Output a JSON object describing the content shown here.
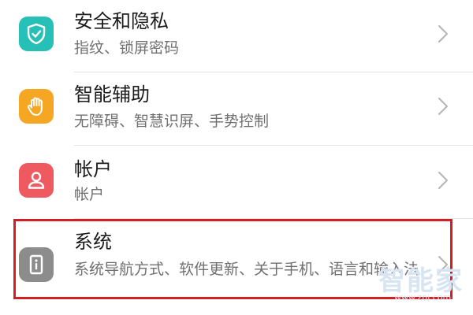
{
  "settings": {
    "items": [
      {
        "title": "安全和隐私",
        "subtitle": "指纹、锁屏密码",
        "icon": "shield-check-icon",
        "color": "#27c0b6"
      },
      {
        "title": "智能辅助",
        "subtitle": "无障碍、智慧识屏、手势控制",
        "icon": "hand-icon",
        "color": "#f5a623"
      },
      {
        "title": "帐户",
        "subtitle": "帐户",
        "icon": "person-icon",
        "color": "#ee5a5f"
      },
      {
        "title": "系统",
        "subtitle": "系统导航方式、软件更新、关于手机、语言和输入法",
        "icon": "info-phone-icon",
        "color": "#8c8c8c"
      }
    ]
  },
  "watermark": {
    "text": "智能家",
    "url": "www.znj.com"
  },
  "highlight_color": "#d21f24"
}
